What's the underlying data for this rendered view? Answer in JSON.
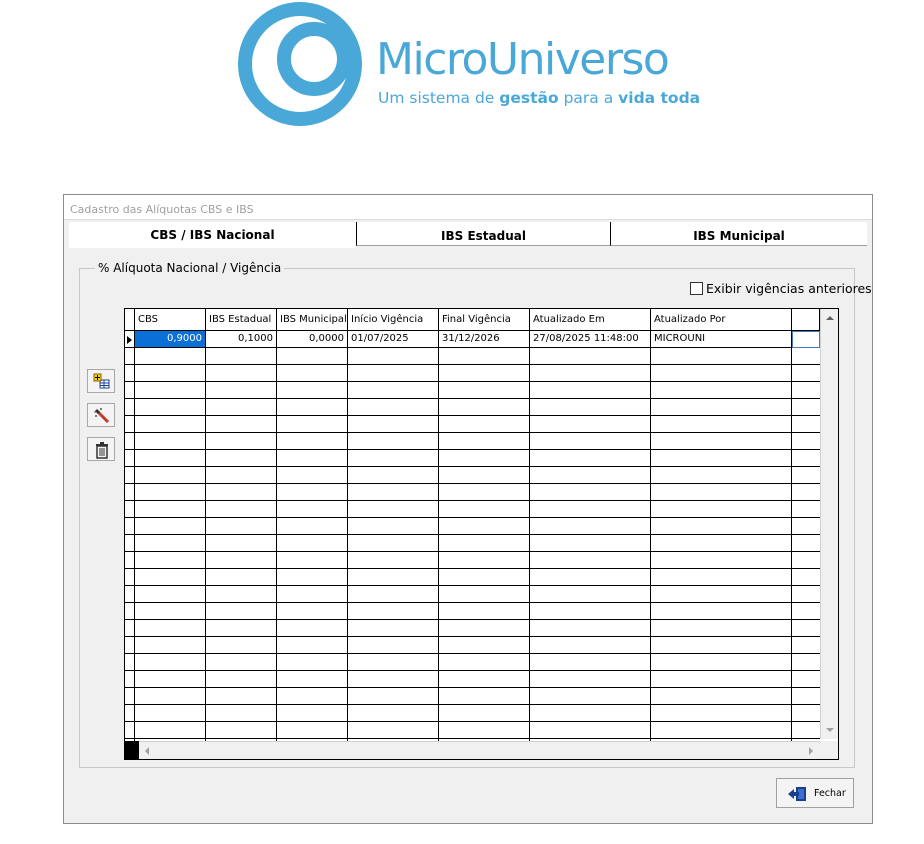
{
  "logo": {
    "name": "MicroUniverso",
    "tagline_part1": "Um sistema de",
    "tagline_bold1": "gestão",
    "tagline_part2": "para a",
    "tagline_bold2": "vida toda"
  },
  "window": {
    "title": "Cadastro das Alíquotas CBS e IBS"
  },
  "tabs": [
    {
      "label": "CBS / IBS Nacional",
      "active": true
    },
    {
      "label": "IBS Estadual",
      "active": false
    },
    {
      "label": "IBS Municipal",
      "active": false
    }
  ],
  "group": {
    "legend": "% Alíquota Nacional / Vigência",
    "show_previous_label": "Exibir vigências anteriores",
    "show_previous_checked": false
  },
  "toolbar": {
    "icons": [
      "add-record-icon",
      "edit-record-icon",
      "delete-record-icon"
    ]
  },
  "grid": {
    "columns": [
      "CBS",
      "IBS Estadual",
      "IBS Municipal",
      "Início Vigência",
      "Final Vigência",
      "Atualizado Em",
      "Atualizado Por"
    ],
    "rows": [
      [
        "0,9000",
        "0,1000",
        "0,0000",
        "01/07/2025",
        "31/12/2026",
        "27/08/2025 11:48:00",
        "MICROUNI"
      ]
    ],
    "selected_row": 0
  },
  "close_button": {
    "label": "Fechar",
    "icon": "exit-door-icon"
  },
  "colors": {
    "brand": "#4aa8d8",
    "selection": "#0a6fd6"
  }
}
